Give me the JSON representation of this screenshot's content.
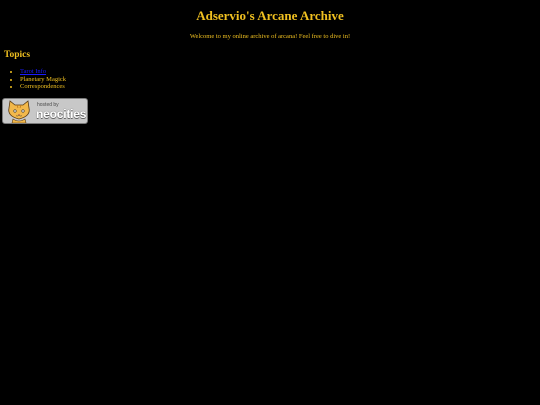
{
  "page": {
    "title": "Adservio's Arcane Archive",
    "welcome": "Welcome to my online archive of arcana! Feel free to dive in!"
  },
  "topics": {
    "heading": "Topics",
    "items": [
      {
        "label": "Tarot Info",
        "is_link": true
      },
      {
        "label": "Planetary Magick",
        "is_link": false
      },
      {
        "label": "Correspondences",
        "is_link": false
      }
    ]
  },
  "badge": {
    "small_text": "hosted by",
    "brand_text": "neocities",
    "icon": "neocities-cat-icon"
  },
  "colors": {
    "background": "#000000",
    "text": "#f0c020",
    "link": "#1a1aff",
    "badge_bg": "#c8c8c8"
  }
}
